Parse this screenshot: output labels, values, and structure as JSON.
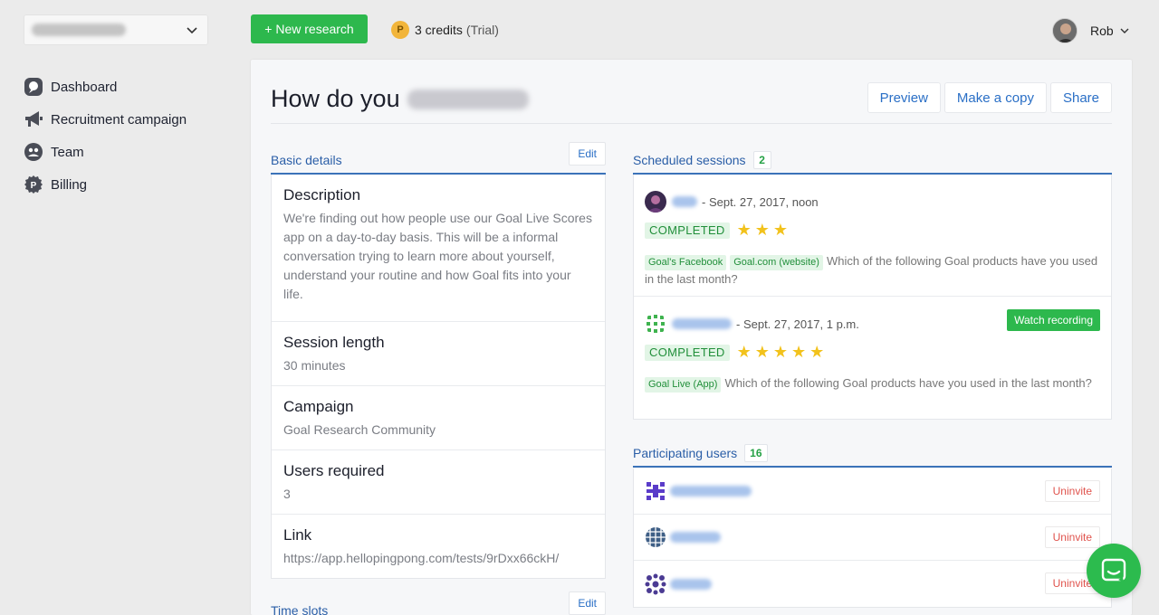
{
  "sidebar": {
    "org_select": {
      "value": ""
    },
    "items": [
      {
        "label": "Dashboard",
        "icon": "dashboard-icon"
      },
      {
        "label": "Recruitment campaign",
        "icon": "megaphone-icon"
      },
      {
        "label": "Team",
        "icon": "team-icon"
      },
      {
        "label": "Billing",
        "icon": "billing-icon"
      }
    ]
  },
  "topbar": {
    "new_research_label": "+ New research",
    "credits_icon": "P",
    "credits_text": "3 credits",
    "credits_suffix": "(Trial)",
    "user_name": "Rob"
  },
  "research": {
    "title": "How do you",
    "actions": {
      "preview": "Preview",
      "copy": "Make a copy",
      "share": "Share"
    }
  },
  "basic_details": {
    "header": "Basic details",
    "edit_label": "Edit",
    "rows": [
      {
        "label": "Description",
        "value": "We're finding out how people use our Goal Live Scores app on a day-to-day basis. This will be a informal conversation trying to learn more about yourself, understand your routine and how Goal fits into your life."
      },
      {
        "label": "Session length",
        "value": "30 minutes"
      },
      {
        "label": "Campaign",
        "value": "Goal Research Community"
      },
      {
        "label": "Users required",
        "value": "3"
      },
      {
        "label": "Link",
        "value": "https://app.hellopingpong.com/tests/9rDxx66ckH/"
      }
    ]
  },
  "time_slots": {
    "header": "Time slots",
    "edit_label": "Edit"
  },
  "scheduled_sessions": {
    "header": "Scheduled sessions",
    "count": "2",
    "sessions": [
      {
        "datetime": "- Sept. 27, 2017, noon",
        "status": "COMPLETED",
        "rating": 3,
        "stars": "★★★",
        "tags": [
          "Goal's Facebook",
          "Goal.com (website)"
        ],
        "question": "Which of the following Goal products have you used in the last month?"
      },
      {
        "datetime": "- Sept. 27, 2017, 1 p.m.",
        "status": "COMPLETED",
        "rating": 5,
        "stars": "★★★★★",
        "tags": [
          "Goal Live (App)"
        ],
        "question": "Which of the following Goal products have you used in the last month?",
        "watch_label": "Watch recording"
      }
    ]
  },
  "participating_users": {
    "header": "Participating users",
    "count": "16",
    "uninvite_label": "Uninvite"
  },
  "chat": {
    "icon": "chat-icon"
  },
  "colors": {
    "accent_green": "#2db84d",
    "link_blue": "#2a6fc6",
    "danger_red": "#e0534d",
    "star_yellow": "#f2c21c"
  }
}
